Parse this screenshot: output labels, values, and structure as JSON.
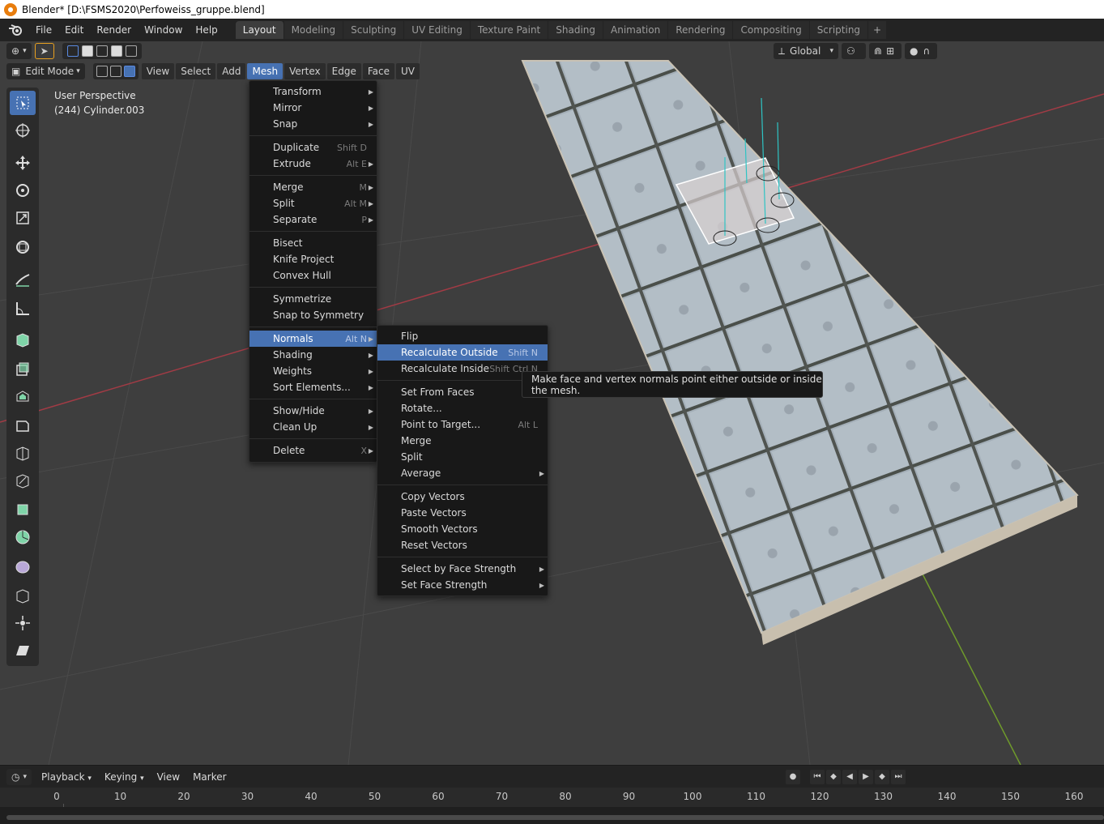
{
  "title": "Blender* [D:\\FSMS2020\\Perfoweiss_gruppe.blend]",
  "menubar": {
    "items": [
      "File",
      "Edit",
      "Render",
      "Window",
      "Help"
    ],
    "workspaces": [
      "Layout",
      "Modeling",
      "Sculpting",
      "UV Editing",
      "Texture Paint",
      "Shading",
      "Animation",
      "Rendering",
      "Compositing",
      "Scripting"
    ],
    "active_workspace": "Layout"
  },
  "header": {
    "transform_orientation": "Global",
    "mode": "Edit Mode",
    "menus": [
      "View",
      "Select",
      "Add",
      "Mesh",
      "Vertex",
      "Edge",
      "Face",
      "UV"
    ],
    "active_menu": "Mesh"
  },
  "viewport": {
    "perspective": "User Perspective",
    "object": "(244) Cylinder.003"
  },
  "mesh_menu": {
    "items": [
      {
        "label": "Transform",
        "shortcut": "",
        "sub": true
      },
      {
        "label": "Mirror",
        "shortcut": "",
        "sub": true
      },
      {
        "label": "Snap",
        "shortcut": "",
        "sub": true
      },
      {
        "sep": true
      },
      {
        "label": "Duplicate",
        "shortcut": "Shift D",
        "sub": false
      },
      {
        "label": "Extrude",
        "shortcut": "Alt E",
        "sub": true
      },
      {
        "sep": true
      },
      {
        "label": "Merge",
        "shortcut": "M",
        "sub": true
      },
      {
        "label": "Split",
        "shortcut": "Alt M",
        "sub": true
      },
      {
        "label": "Separate",
        "shortcut": "P",
        "sub": true
      },
      {
        "sep": true
      },
      {
        "label": "Bisect",
        "shortcut": "",
        "sub": false
      },
      {
        "label": "Knife Project",
        "shortcut": "",
        "sub": false
      },
      {
        "label": "Convex Hull",
        "shortcut": "",
        "sub": false
      },
      {
        "sep": true
      },
      {
        "label": "Symmetrize",
        "shortcut": "",
        "sub": false
      },
      {
        "label": "Snap to Symmetry",
        "shortcut": "",
        "sub": false
      },
      {
        "sep": true
      },
      {
        "label": "Normals",
        "shortcut": "Alt N",
        "sub": true,
        "hl": true
      },
      {
        "label": "Shading",
        "shortcut": "",
        "sub": true
      },
      {
        "label": "Weights",
        "shortcut": "",
        "sub": true
      },
      {
        "label": "Sort Elements...",
        "shortcut": "",
        "sub": true
      },
      {
        "sep": true
      },
      {
        "label": "Show/Hide",
        "shortcut": "",
        "sub": true
      },
      {
        "label": "Clean Up",
        "shortcut": "",
        "sub": true
      },
      {
        "sep": true
      },
      {
        "label": "Delete",
        "shortcut": "X",
        "sub": true
      }
    ]
  },
  "normals_menu": {
    "items": [
      {
        "label": "Flip",
        "shortcut": "",
        "sub": false
      },
      {
        "label": "Recalculate Outside",
        "shortcut": "Shift N",
        "sub": false,
        "hl": true
      },
      {
        "label": "Recalculate Inside",
        "shortcut": "Shift Ctrl N",
        "sub": false
      },
      {
        "sep": true
      },
      {
        "label": "Set From Faces",
        "shortcut": "",
        "sub": false
      },
      {
        "label": "Rotate...",
        "shortcut": "",
        "sub": false
      },
      {
        "label": "Point to Target...",
        "shortcut": "Alt L",
        "sub": false
      },
      {
        "label": "Merge",
        "shortcut": "",
        "sub": false
      },
      {
        "label": "Split",
        "shortcut": "",
        "sub": false
      },
      {
        "label": "Average",
        "shortcut": "",
        "sub": true
      },
      {
        "sep": true
      },
      {
        "label": "Copy Vectors",
        "shortcut": "",
        "sub": false
      },
      {
        "label": "Paste Vectors",
        "shortcut": "",
        "sub": false
      },
      {
        "label": "Smooth Vectors",
        "shortcut": "",
        "sub": false
      },
      {
        "label": "Reset Vectors",
        "shortcut": "",
        "sub": false
      },
      {
        "sep": true
      },
      {
        "label": "Select by Face Strength",
        "shortcut": "",
        "sub": true
      },
      {
        "label": "Set Face Strength",
        "shortcut": "",
        "sub": true
      }
    ]
  },
  "tooltip": "Make face and vertex normals point either outside or inside the mesh.",
  "timeline": {
    "menus": [
      "Playback",
      "Keying",
      "View",
      "Marker"
    ],
    "ticks": [
      "0",
      "10",
      "20",
      "30",
      "40",
      "50",
      "60",
      "70",
      "80",
      "90",
      "100",
      "110",
      "120",
      "130",
      "140",
      "150",
      "160"
    ]
  },
  "colors": {
    "accent": "#4772b3",
    "menu_bg": "#181818",
    "viewport_bg": "#3e3e3e",
    "x_axis": "#a23b45",
    "y_axis": "#6f9a2b"
  }
}
